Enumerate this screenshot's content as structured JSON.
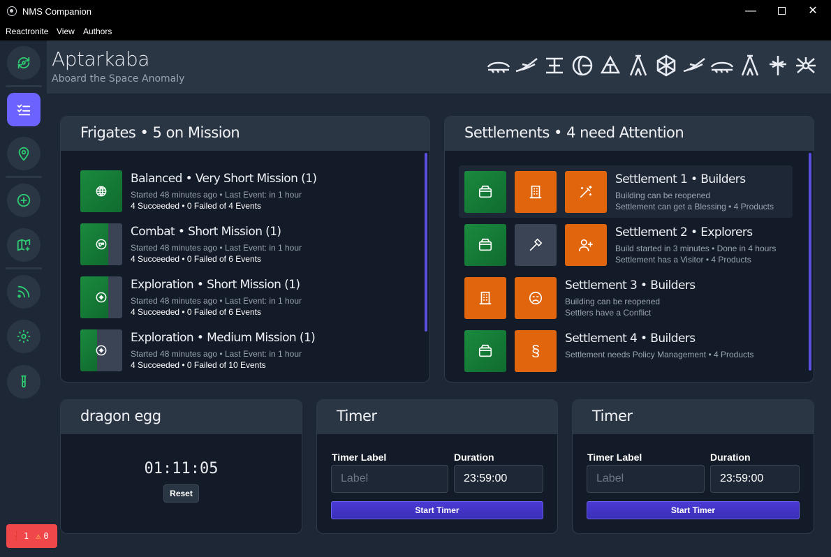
{
  "window": {
    "title": "NMS Companion"
  },
  "menu": [
    "Reactronite",
    "View",
    "Authors"
  ],
  "header": {
    "name": "Aptarkaba",
    "subtitle": "Aboard the Space Anomaly"
  },
  "badges": {
    "errors": "1",
    "warnings": "0"
  },
  "frigates": {
    "title": "Frigates • 5 on Mission",
    "items": [
      {
        "title": "Balanced • Very Short Mission (1)",
        "line1": "Started 48 minutes ago • Last Event: in 1 hour",
        "line2": "4 Succeeded • 0 Failed of 4 Events",
        "icon": "globe-icon",
        "progress": 1.0
      },
      {
        "title": "Combat • Short Mission (1)",
        "line1": "Started 48 minutes ago • Last Event: in 1 hour",
        "line2": "4 Succeeded • 0 Failed of 6 Events",
        "icon": "gun-icon",
        "progress": 0.67
      },
      {
        "title": "Exploration • Short Mission (1)",
        "line1": "Started 48 minutes ago • Last Event: in 1 hour",
        "line2": "4 Succeeded • 0 Failed of 6 Events",
        "icon": "compass-icon",
        "progress": 0.67
      },
      {
        "title": "Exploration • Medium Mission (1)",
        "line1": "Started 48 minutes ago • Last Event: in 1 hour",
        "line2": "4 Succeeded • 0 Failed of 10 Events",
        "icon": "compass-icon",
        "progress": 0.4
      }
    ]
  },
  "settlements": {
    "title": "Settlements • 4 need Attention",
    "items": [
      {
        "title": "Settlement 1 • Builders",
        "line1": "Building can be reopened",
        "line2": "Settlement can get a Blessing • 4 Products"
      },
      {
        "title": "Settlement 2 • Explorers",
        "line1": "Build started in 3 minutes • Done in 4 hours",
        "line2": "Settlement has a Visitor • 4 Products"
      },
      {
        "title": "Settlement 3 • Builders",
        "line1": "Building can be reopened",
        "line2": "Settlers have a Conflict"
      },
      {
        "title": "Settlement 4 • Builders",
        "line1": "Settlement needs Policy Management • 4 Products",
        "line2": ""
      }
    ]
  },
  "egg": {
    "title": "dragon egg",
    "time": "01:11:05",
    "reset_label": "Reset"
  },
  "timers": [
    {
      "title": "Timer",
      "label_caption": "Timer Label",
      "duration_caption": "Duration",
      "label_placeholder": "Label",
      "duration_value": "23:59:00",
      "start_label": "Start Timer"
    },
    {
      "title": "Timer",
      "label_caption": "Timer Label",
      "duration_caption": "Duration",
      "label_placeholder": "Label",
      "duration_value": "23:59:00",
      "start_label": "Start Timer"
    }
  ],
  "colors": {
    "accent": "#6c63ff",
    "nav_icon": "#2ecc71",
    "green_tile": "#1a8a3e",
    "orange_tile": "#e0650c",
    "error_badge": "#f0474b"
  }
}
